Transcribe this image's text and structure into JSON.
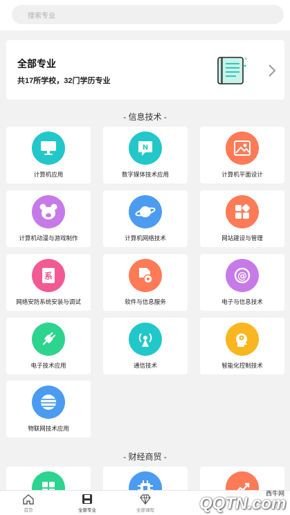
{
  "search": {
    "placeholder": "搜索专业"
  },
  "summary": {
    "title": "全部专业",
    "subtitle": "共17所学校，32门学历专业"
  },
  "sections": [
    {
      "title": "- 信息技术 -",
      "items": [
        {
          "label": "计算机应用",
          "icon": "monitor-icon",
          "color": "#22c7c9"
        },
        {
          "label": "数字媒体技术应用",
          "icon": "chat-n-icon",
          "color": "#22c7c9"
        },
        {
          "label": "计算机平面设计",
          "icon": "image-icon",
          "color": "#ff7a57"
        },
        {
          "label": "计算机动漫与游戏制作",
          "icon": "bear-icon",
          "color": "#c67ae8"
        },
        {
          "label": "计算机网络技术",
          "icon": "planet-icon",
          "color": "#4b9cf0"
        },
        {
          "label": "网站建设与管理",
          "icon": "apps-icon",
          "color": "#ff7a57"
        },
        {
          "label": "网络安防系统安装与调试",
          "icon": "document-icon",
          "color": "#f35a94"
        },
        {
          "label": "软件与信息服务",
          "icon": "file-gear-icon",
          "color": "#ff7a57"
        },
        {
          "label": "电子与信息技术",
          "icon": "at-icon",
          "color": "#c67ae8"
        },
        {
          "label": "电子技术应用",
          "icon": "plug-icon",
          "color": "#2dd48f"
        },
        {
          "label": "通信技术",
          "icon": "antenna-icon",
          "color": "#22c7c9"
        },
        {
          "label": "智能化控制技术",
          "icon": "head-gear-icon",
          "color": "#f9b620"
        },
        {
          "label": "物联网技术应用",
          "icon": "globe-icon",
          "color": "#4b9cf0"
        }
      ]
    },
    {
      "title": "- 财经商贸 -",
      "items": [
        {
          "label": "",
          "icon": "calculator-icon",
          "color": "#2dd48f"
        },
        {
          "label": "",
          "icon": "chip-icon",
          "color": "#4b9cf0"
        },
        {
          "label": "",
          "icon": "trend-icon",
          "color": "#ff7a57"
        }
      ]
    }
  ],
  "tabbar": [
    {
      "label": "首页",
      "icon": "home-icon"
    },
    {
      "label": "全部专业",
      "icon": "save-icon",
      "active": true
    },
    {
      "label": "全部课程",
      "icon": "diamond-icon"
    }
  ],
  "watermark": {
    "site": "西牛网",
    "brand": "QQTN.com"
  }
}
